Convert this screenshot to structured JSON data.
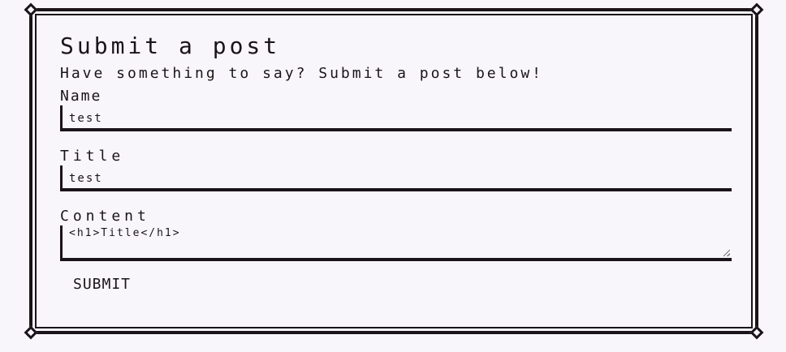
{
  "form": {
    "heading": "Submit a post",
    "subheading": "Have something to say? Submit a post below!",
    "name": {
      "label": "Name",
      "value": "test"
    },
    "title": {
      "label": "Title",
      "value": "test"
    },
    "content": {
      "label": "Content",
      "value": "<h1>Title</h1>"
    },
    "submit_label": "SUBMIT"
  }
}
